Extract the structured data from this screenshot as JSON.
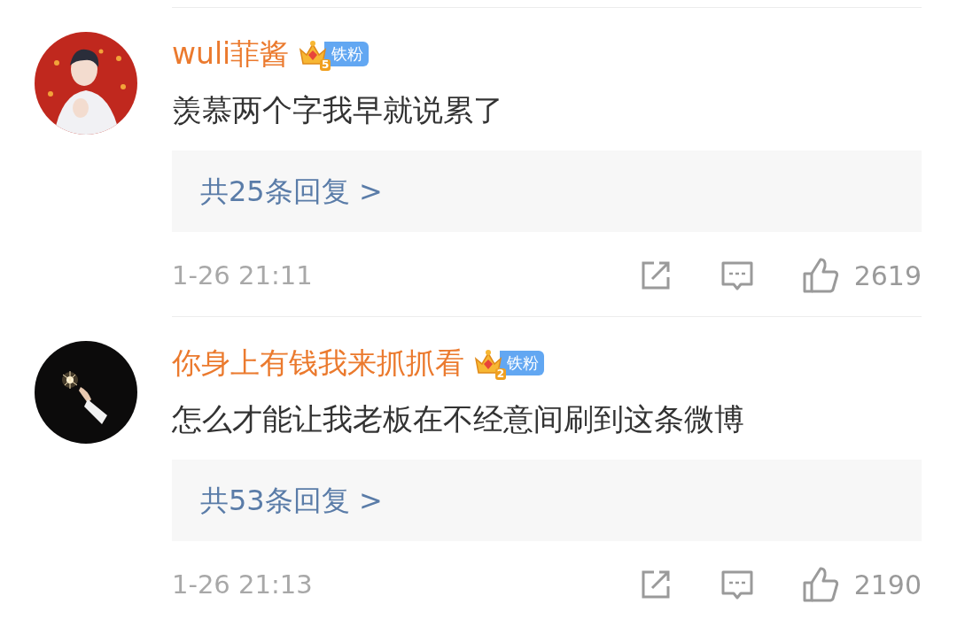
{
  "comments": [
    {
      "username": "wuli菲酱",
      "badge": {
        "level": "5",
        "label": "铁粉"
      },
      "text": "羡慕两个字我早就说累了",
      "replies": "共25条回复 >",
      "time": "1-26 21:11",
      "likes": "2619"
    },
    {
      "username": "你身上有钱我来抓抓看",
      "badge": {
        "level": "2",
        "label": "铁粉"
      },
      "text": "怎么才能让我老板在不经意间刷到这条微博",
      "replies": "共53条回复 >",
      "time": "1-26 21:13",
      "likes": "2190"
    }
  ]
}
